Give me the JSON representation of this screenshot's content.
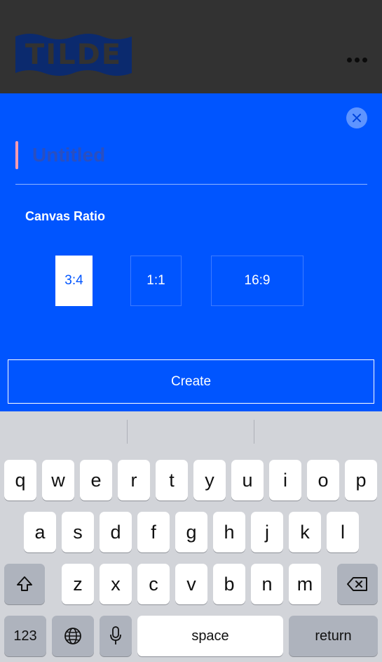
{
  "header": {
    "logo_text": "TILDE",
    "more_icon": "more-horizontal-icon"
  },
  "colors": {
    "header_bg": "#323232",
    "logo_bg": "#0b2a6e",
    "modal_bg": "#0055ff",
    "selected_bg": "#ffffff",
    "keyboard_bg": "#d2d4d9"
  },
  "modal": {
    "close_icon": "close-icon",
    "title_placeholder": "Untitled",
    "title_value": "",
    "canvas_ratio_label": "Canvas Ratio",
    "ratios": [
      {
        "label": "3:4",
        "selected": true
      },
      {
        "label": "1:1",
        "selected": false
      },
      {
        "label": "16:9",
        "selected": false
      }
    ],
    "create_label": "Create"
  },
  "keyboard": {
    "row1": [
      "q",
      "w",
      "e",
      "r",
      "t",
      "y",
      "u",
      "i",
      "o",
      "p"
    ],
    "row2": [
      "a",
      "s",
      "d",
      "f",
      "g",
      "h",
      "j",
      "k",
      "l"
    ],
    "row3": [
      "z",
      "x",
      "c",
      "v",
      "b",
      "n",
      "m"
    ],
    "shift_icon": "shift-icon",
    "backspace_icon": "backspace-icon",
    "numbers_label": "123",
    "globe_icon": "globe-icon",
    "mic_icon": "microphone-icon",
    "space_label": "space",
    "return_label": "return"
  }
}
